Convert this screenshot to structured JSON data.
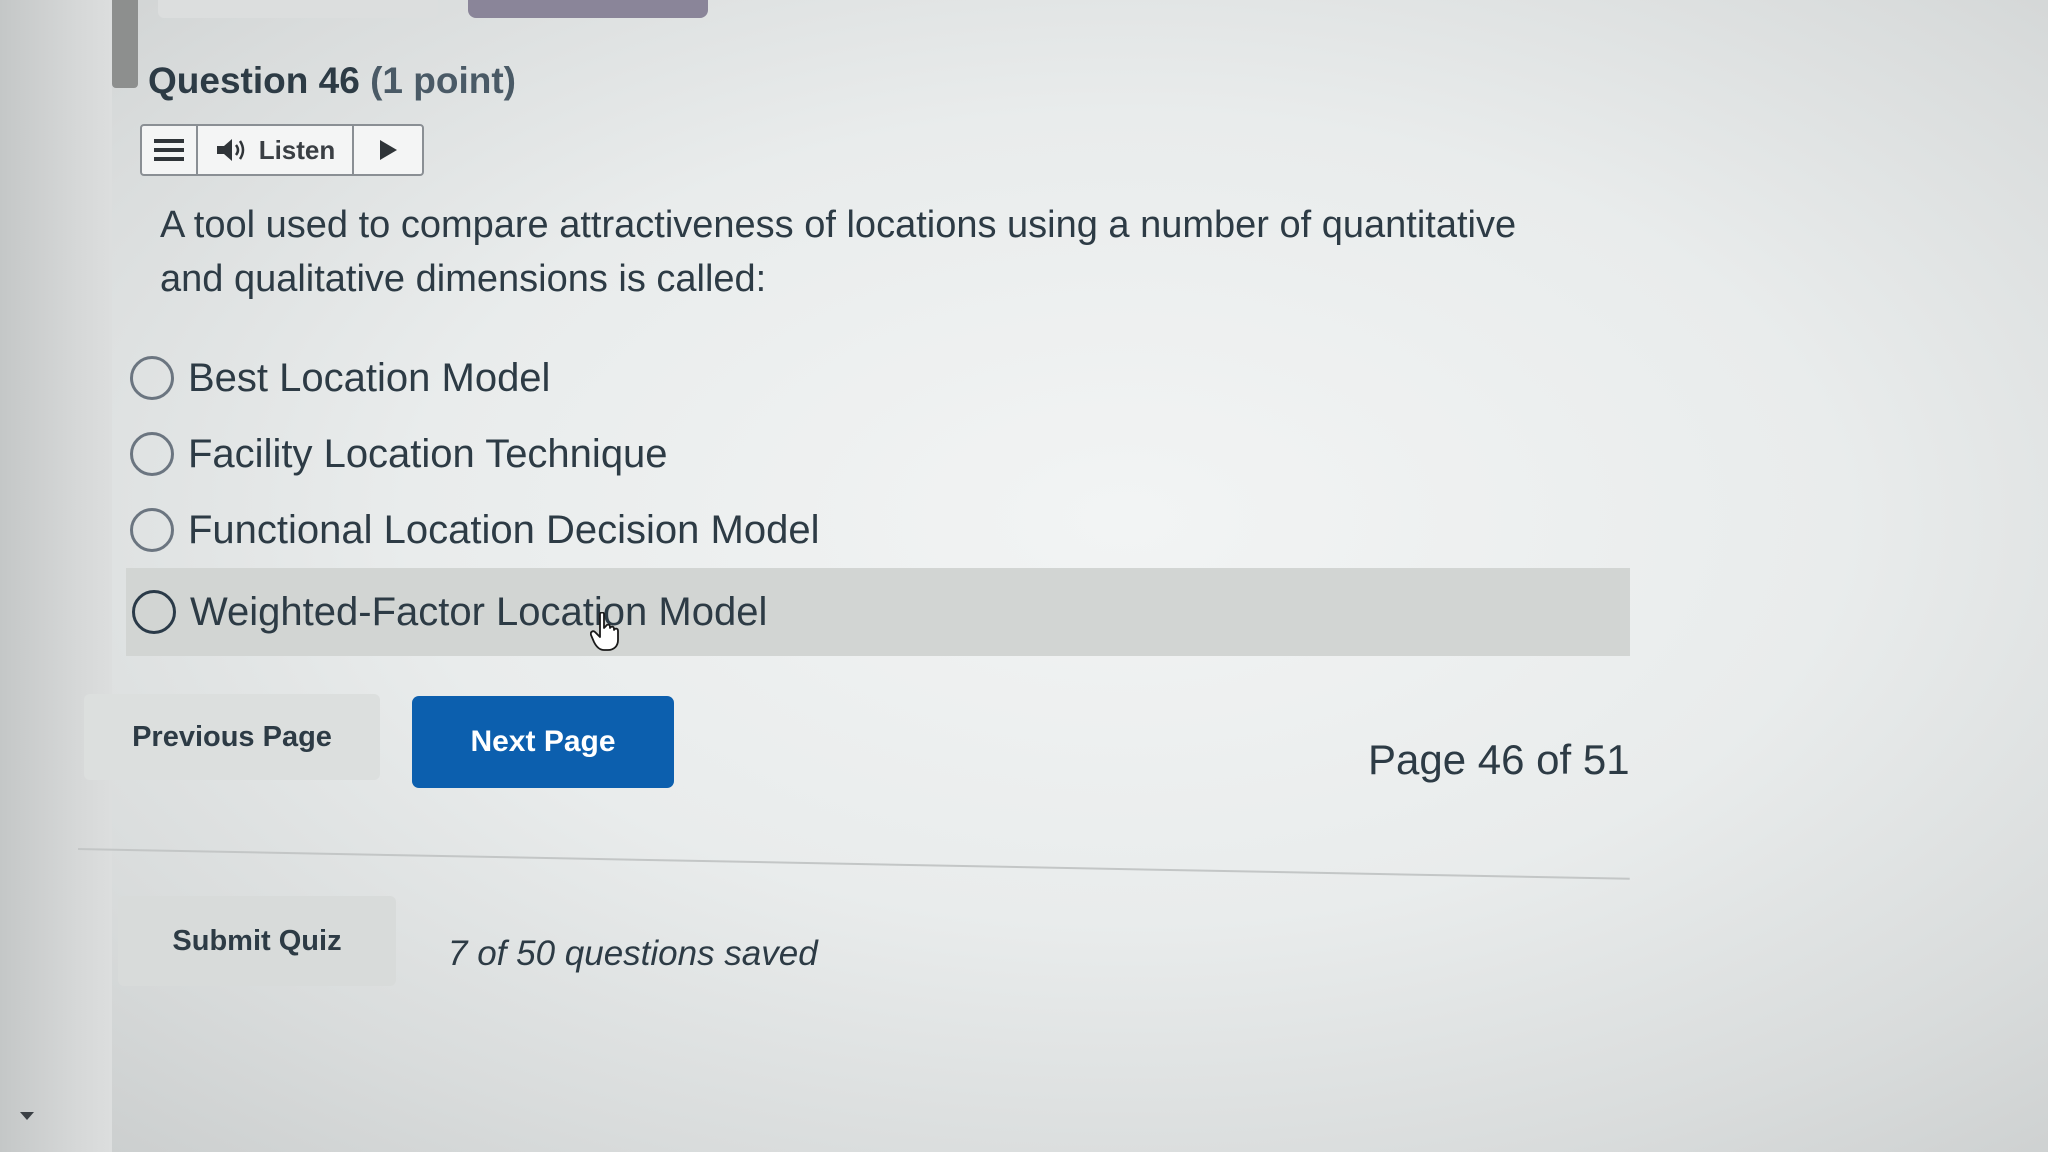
{
  "question": {
    "number_label": "Question 46",
    "points_label": "(1 point)",
    "text": "A tool used to compare attractiveness of locations using a number of quantitative and qualitative dimensions is called:"
  },
  "listen_toolbar": {
    "menu_icon": "hamburger-menu-icon",
    "speaker_icon": "speaker-icon",
    "listen_label": "Listen",
    "play_icon": "play-icon"
  },
  "answers": [
    {
      "label": "Best Location Model",
      "selected": false
    },
    {
      "label": "Facility Location Technique",
      "selected": false
    },
    {
      "label": "Functional Location Decision Model",
      "selected": false
    },
    {
      "label": "Weighted-Factor Location Model",
      "selected": false
    }
  ],
  "navigation": {
    "previous_label": "Previous Page",
    "next_label": "Next Page",
    "page_indicator": "Page 46 of 51"
  },
  "footer": {
    "submit_label": "Submit Quiz",
    "saved_status": "7 of 50 questions saved"
  },
  "colors": {
    "primary_button": "#0c5fae",
    "text": "#2d3b45",
    "hover_row": "#d2d5d3"
  }
}
